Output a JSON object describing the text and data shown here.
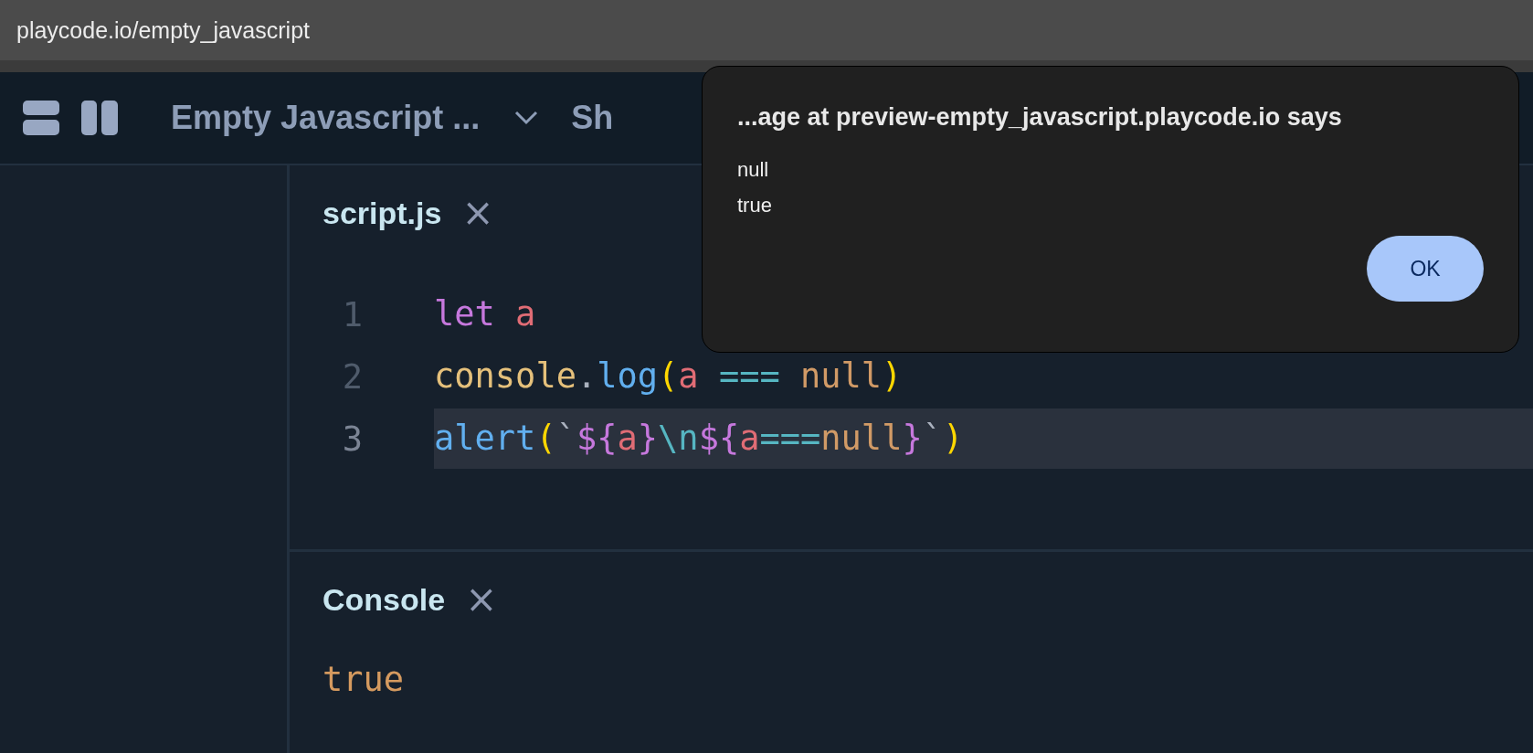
{
  "address_bar": {
    "url": "playcode.io/empty_javascript"
  },
  "toolbar": {
    "project_title": "Empty Javascript ...",
    "next_item": "Sh"
  },
  "editor": {
    "tab": {
      "label": "script.js",
      "close": "×"
    },
    "lines": [
      {
        "number": "1",
        "active": false,
        "tokens": [
          {
            "text": "let ",
            "kind": "keyword"
          },
          {
            "text": "a",
            "kind": "variable"
          }
        ]
      },
      {
        "number": "2",
        "active": false,
        "tokens": [
          {
            "text": "console",
            "kind": "object"
          },
          {
            "text": ".",
            "kind": "punct"
          },
          {
            "text": "log",
            "kind": "function"
          },
          {
            "text": "(",
            "kind": "paren"
          },
          {
            "text": "a ",
            "kind": "variable"
          },
          {
            "text": "=== ",
            "kind": "operator"
          },
          {
            "text": "null",
            "kind": "literal"
          },
          {
            "text": ")",
            "kind": "paren"
          }
        ]
      },
      {
        "number": "3",
        "active": true,
        "tokens": [
          {
            "text": "alert",
            "kind": "function"
          },
          {
            "text": "(",
            "kind": "paren"
          },
          {
            "text": "`",
            "kind": "punct"
          },
          {
            "text": "${",
            "kind": "keyword"
          },
          {
            "text": "a",
            "kind": "variable"
          },
          {
            "text": "}",
            "kind": "keyword"
          },
          {
            "text": "\\n",
            "kind": "operator"
          },
          {
            "text": "${",
            "kind": "keyword"
          },
          {
            "text": "a",
            "kind": "variable"
          },
          {
            "text": "===",
            "kind": "operator"
          },
          {
            "text": "null",
            "kind": "literal"
          },
          {
            "text": "}",
            "kind": "keyword"
          },
          {
            "text": "`",
            "kind": "punct"
          },
          {
            "text": ")",
            "kind": "paren"
          }
        ]
      }
    ]
  },
  "console": {
    "tab": {
      "label": "Console",
      "close": "×"
    },
    "output": [
      "true"
    ]
  },
  "dialog": {
    "title": "...age at preview-empty_javascript.playcode.io says",
    "message": [
      "null",
      "true"
    ],
    "button": "OK"
  }
}
